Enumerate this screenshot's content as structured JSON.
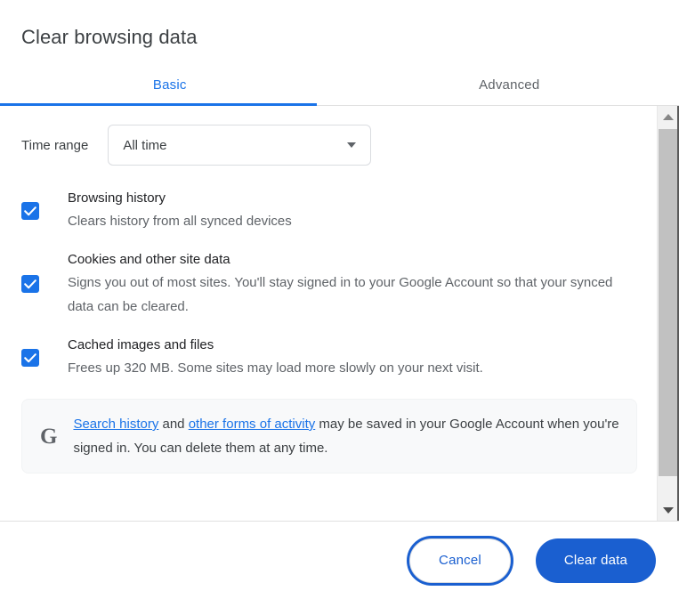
{
  "dialog": {
    "title": "Clear browsing data"
  },
  "tabs": [
    {
      "label": "Basic",
      "selected": true
    },
    {
      "label": "Advanced",
      "selected": false
    }
  ],
  "time_range": {
    "label": "Time range",
    "selected_value": "All time",
    "dropdown_icon": "chevron-down-icon"
  },
  "options": [
    {
      "title": "Browsing history",
      "description": "Clears history from all synced devices",
      "checked": true
    },
    {
      "title": "Cookies and other site data",
      "description": "Signs you out of most sites. You'll stay signed in to your Google Account so that your synced data can be cleared.",
      "checked": true
    },
    {
      "title": "Cached images and files",
      "description": "Frees up 320 MB. Some sites may load more slowly on your next visit.",
      "checked": true
    }
  ],
  "info_card": {
    "logo": "google-g-icon",
    "link1": "Search history",
    "text_mid1": " and ",
    "link2": "other forms of activity",
    "text_tail": " may be saved in your Google Account when you're signed in. You can delete them at any time."
  },
  "scrollbar": {
    "up_icon": "scroll-up-arrow-icon",
    "down_icon": "scroll-down-arrow-icon"
  },
  "footer": {
    "cancel_label": "Cancel",
    "primary_label": "Clear data"
  },
  "colors": {
    "accent_blue": "#1a73e8",
    "button_blue": "#1a5fd0",
    "text_primary": "#202124",
    "text_secondary": "#5f6368",
    "card_bg": "#f8f9fa"
  }
}
